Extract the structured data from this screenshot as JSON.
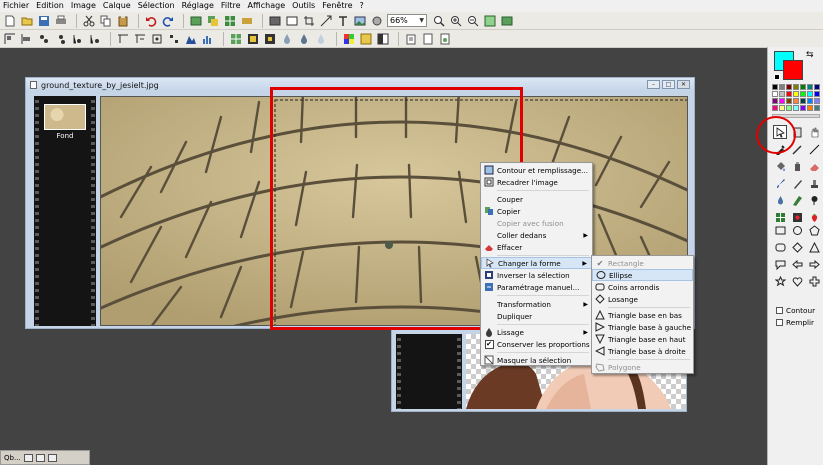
{
  "menubar": {
    "items": [
      "Fichier",
      "Edition",
      "Image",
      "Calque",
      "Sélection",
      "Réglage",
      "Filtre",
      "Affichage",
      "Outils",
      "Fenêtre",
      "?"
    ]
  },
  "toolbar": {
    "zoom_value": "66%"
  },
  "image_window": {
    "title": "ground_texture_by_jesielt.jpg",
    "layer_label": "Fond"
  },
  "context_menu": {
    "items": [
      {
        "label": "Contour et remplissage...",
        "icon": "contour-icon"
      },
      {
        "label": "Recadrer l'image",
        "icon": "crop-icon"
      },
      {
        "label": "Couper",
        "icon": ""
      },
      {
        "label": "Copier",
        "icon": "copy-icon"
      },
      {
        "label": "Copier avec fusion",
        "icon": "",
        "disabled": true
      },
      {
        "label": "Coller dedans",
        "icon": "",
        "submenu": true
      },
      {
        "label": "Effacer",
        "icon": "eraser-icon"
      },
      {
        "label": "Changer la forme",
        "icon": "pointer-icon",
        "submenu": true,
        "highlighted": true
      },
      {
        "label": "Inverser la sélection",
        "icon": "invert-icon"
      },
      {
        "label": "Paramétrage manuel...",
        "icon": "settings-icon"
      },
      {
        "label": "Transformation",
        "icon": "",
        "submenu": true
      },
      {
        "label": "Dupliquer",
        "icon": ""
      },
      {
        "label": "Lissage",
        "icon": "drop-icon",
        "submenu": true
      },
      {
        "label": "Conserver les proportions",
        "icon": "check-icon"
      },
      {
        "label": "Masquer la sélection",
        "icon": "hide-icon"
      }
    ]
  },
  "shape_submenu": {
    "items": [
      {
        "label": "Rectangle",
        "icon": "check-icon",
        "disabled": true
      },
      {
        "label": "Ellipse",
        "icon": "ellipse-icon",
        "highlighted": true
      },
      {
        "label": "Coins arrondis",
        "icon": "rounded-rect-icon"
      },
      {
        "label": "Losange",
        "icon": "diamond-icon"
      },
      {
        "label": "Triangle base en bas",
        "icon": "triangle-up-icon"
      },
      {
        "label": "Triangle base à gauche",
        "icon": "triangle-right-icon"
      },
      {
        "label": "Triangle base en haut",
        "icon": "triangle-down-icon"
      },
      {
        "label": "Triangle base à droite",
        "icon": "triangle-left-icon"
      },
      {
        "label": "Polygone",
        "icon": "polygon-icon",
        "disabled": true
      }
    ]
  },
  "tool_panel": {
    "foreground_color": "#00ffff",
    "background_color": "#ff0000",
    "contour_label": "Contour",
    "remplir_label": "Remplir"
  },
  "taskbar": {
    "label": "Qb..."
  }
}
